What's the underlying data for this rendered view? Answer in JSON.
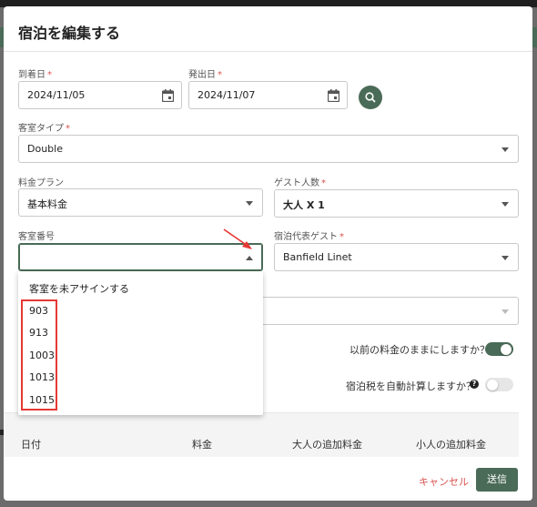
{
  "dialog": {
    "title": "宿泊を編集する"
  },
  "form": {
    "arrival": {
      "label": "到着日",
      "value": "2024/11/05"
    },
    "departure": {
      "label": "発出日",
      "value": "2024/11/07"
    },
    "room_type": {
      "label": "客室タイプ",
      "value": "Double"
    },
    "rate_plan": {
      "label": "料金プラン",
      "value": "基本料金"
    },
    "guests": {
      "label": "ゲスト人数",
      "value": "大人 X 1"
    },
    "room_number": {
      "label": "客室番号",
      "value": ""
    },
    "rep_guest": {
      "label": "宿泊代表ゲスト",
      "value": "Banfield Linet"
    },
    "required_mark": "*"
  },
  "room_dropdown": {
    "unassign": "客室を未アサインする",
    "options": [
      "903",
      "913",
      "1003",
      "1013",
      "1015"
    ]
  },
  "toggles": {
    "keep_rate": {
      "label": "以前の料金のままにしますか？",
      "on": true
    },
    "auto_tax": {
      "label": "宿泊税を自動計算しますか？",
      "on": false
    },
    "help": "?"
  },
  "table": {
    "headers": [
      "日付",
      "料金",
      "大人の追加料金",
      "小人の追加料金"
    ]
  },
  "footer": {
    "cancel": "キャンセル",
    "submit": "送信"
  },
  "colors": {
    "primary": "#4a6b57",
    "danger": "#d9534f",
    "annotation": "#e53935"
  },
  "icons": [
    "calendar-icon",
    "search-icon",
    "chevron-down-icon",
    "chevron-up-icon",
    "help-icon",
    "annotation-arrow-icon"
  ]
}
